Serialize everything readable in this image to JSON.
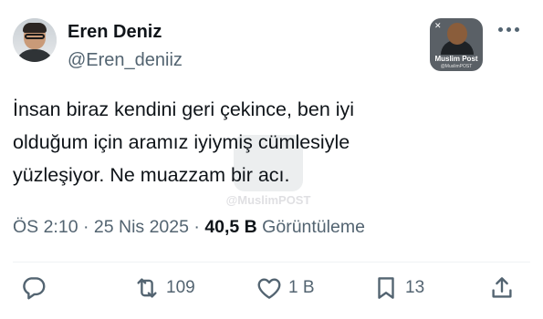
{
  "author": {
    "name": "Eren Deniz",
    "handle": "@Eren_deniiz"
  },
  "badge": {
    "title": "Muslim Post",
    "subtitle": "@MuslimPOST"
  },
  "watermark": {
    "text": "@MuslimPOST"
  },
  "tweet": {
    "line1": "İnsan biraz kendini geri çekince, ben iyi",
    "line2": "olduğum için aramız iyiymiş cümlesiyle",
    "line3": "yüzleşiyor. Ne muazzam bir acı."
  },
  "meta": {
    "time": "ÖS 2:10",
    "sep1": " · ",
    "date": "25 Nis 2025",
    "sep2": " · ",
    "views_count": "40,5 B",
    "views_label": " Görüntüleme"
  },
  "actions": {
    "reply_count": "",
    "retweet_count": "109",
    "like_count": "1 B",
    "bookmark_count": "13"
  },
  "icons": {
    "more": "more-horizontal-icon",
    "reply": "reply-icon",
    "retweet": "retweet-icon",
    "like": "heart-icon",
    "bookmark": "bookmark-icon",
    "share": "share-icon"
  },
  "colors": {
    "text": "#0f1419",
    "secondary": "#536471",
    "divider": "#eff3f4"
  }
}
